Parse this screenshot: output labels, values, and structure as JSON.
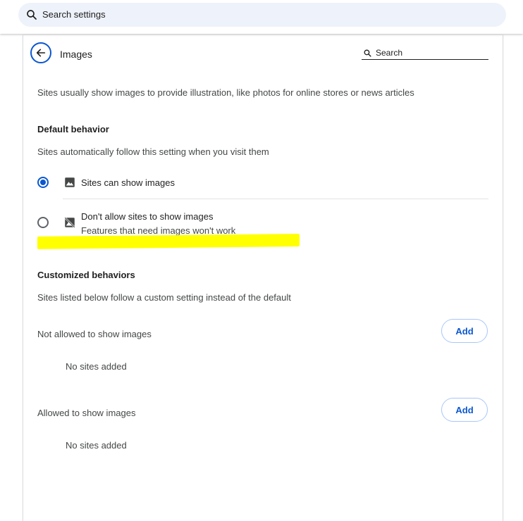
{
  "topbar": {
    "search_label": "Search settings",
    "search_icon": "search-icon"
  },
  "header": {
    "title": "Images",
    "back_icon": "arrow-back-icon",
    "search_label": "Search"
  },
  "intro": "Sites usually show images to provide illustration, like photos for online stores or news articles",
  "default_behavior": {
    "heading": "Default behavior",
    "description": "Sites automatically follow this setting when you visit them",
    "options": [
      {
        "label": "Sites can show images",
        "sublabel": "",
        "selected": true,
        "icon": "image-icon"
      },
      {
        "label": "Don't allow sites to show images",
        "sublabel": "Features that need images won't work",
        "selected": false,
        "icon": "image-off-icon"
      }
    ]
  },
  "customized": {
    "heading": "Customized behaviors",
    "description": "Sites listed below follow a custom setting instead of the default",
    "lists": [
      {
        "label": "Not allowed to show images",
        "add_label": "Add",
        "empty_text": "No sites added"
      },
      {
        "label": "Allowed to show images",
        "add_label": "Add",
        "empty_text": "No sites added"
      }
    ]
  },
  "colors": {
    "accent": "#0b57d0",
    "highlight": "#ffff00",
    "search_bg": "#eef2fa"
  }
}
